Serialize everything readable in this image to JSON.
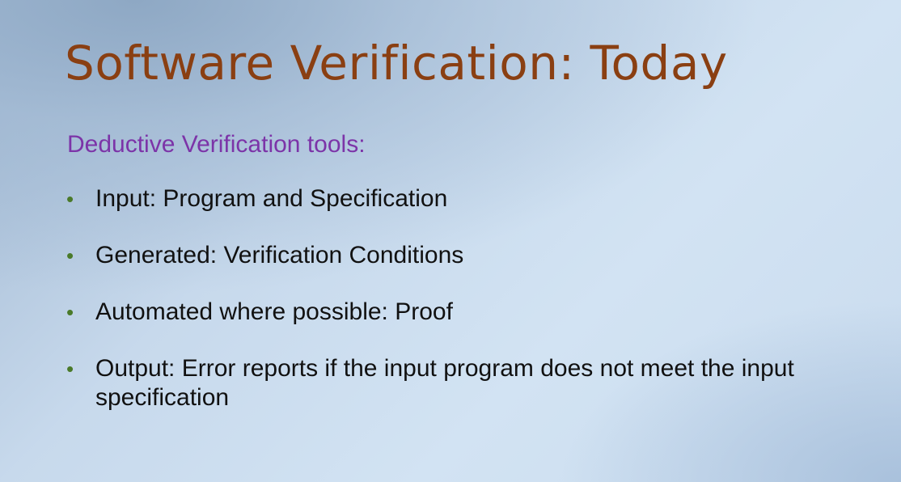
{
  "slide": {
    "title": "Software Verification: Today",
    "subheading": "Deductive Verification tools:",
    "bullets": [
      "Input: Program and Specification",
      "Generated: Verification Conditions",
      "Automated where possible: Proof",
      "Output: Error reports if the input program does not meet the input specification"
    ],
    "bullet_glyph": "•"
  },
  "colors": {
    "title": "#8a3f12",
    "subheading": "#7c34a8",
    "bullet_marker": "#4a7a2a",
    "body_text": "#111111"
  }
}
